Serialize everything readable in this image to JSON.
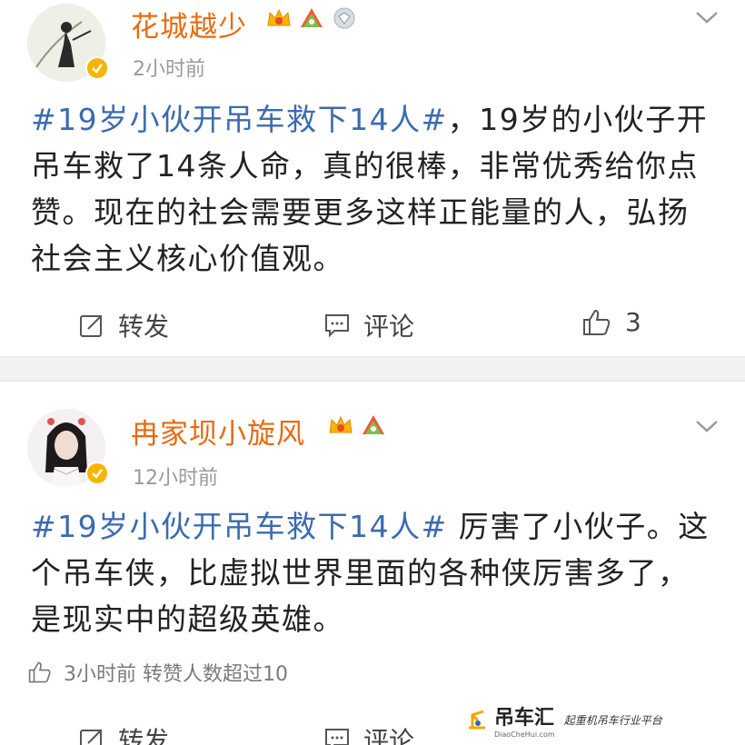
{
  "post1": {
    "username": "花城越少",
    "time": "2小时前",
    "topic": "#19岁小伙开吊车救下14人#",
    "text": "，19岁的小伙子开吊车救了14条人命，真的很棒，非常优秀给你点赞。现在的社会需要更多这样正能量的人，弘扬社会主义核心价值观。",
    "actions": {
      "repost_label": "转发",
      "comment_label": "评论",
      "like_count": "3"
    }
  },
  "post2": {
    "username": "冉家坝小旋风",
    "time": "12小时前",
    "topic": "#19岁小伙开吊车救下14人#",
    "text": " 厉害了小伙子。这个吊车侠，比虚拟世界里面的各种侠厉害多了，是现实中的超级英雄。",
    "meta": "3小时前 转赞人数超过10",
    "actions": {
      "repost_label": "转发",
      "comment_label": "评论"
    }
  },
  "watermark": {
    "logo": "吊车汇",
    "site": "DiaoCheHui.com",
    "slogan": "起重机吊车行业平台"
  },
  "colors": {
    "username": "#e86a10",
    "topic": "#3b6bb0",
    "separator": "#f2f2f2"
  },
  "icons": [
    "verified-icon",
    "vip-crown-icon",
    "fan-badge-icon",
    "diamond-icon",
    "chevron-down-icon",
    "repost-icon",
    "comment-icon",
    "like-icon"
  ]
}
